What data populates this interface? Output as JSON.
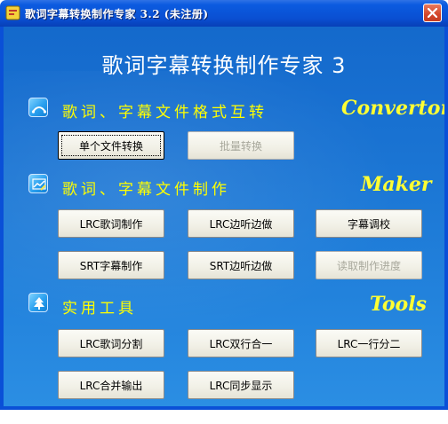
{
  "window": {
    "title": "歌词字幕转换制作专家 3.2 (未注册)"
  },
  "app_title": "歌词字幕转换制作专家 3",
  "sections": {
    "converter": {
      "title": "歌词、字幕文件格式互转",
      "tag": "Convertor",
      "icon": "arc-curve-icon",
      "buttons": {
        "single": "单个文件转换",
        "batch": "批量转换"
      }
    },
    "maker": {
      "title": "歌词、字幕文件制作",
      "tag": "Maker",
      "icon": "chart-edit-icon",
      "buttons": {
        "lrc_make": "LRC歌词制作",
        "lrc_listen": "LRC边听边做",
        "subtitle_adjust": "字幕调校",
        "srt_make": "SRT字幕制作",
        "srt_listen": "SRT边听边做",
        "read_progress": "读取制作进度"
      }
    },
    "tools": {
      "title": "实用工具",
      "tag": "Tools",
      "icon": "tree-icon",
      "buttons": {
        "lrc_split": "LRC歌词分割",
        "lrc_merge_lines": "LRC双行合一",
        "lrc_split_lines": "LRC一行分二",
        "lrc_merge_output": "LRC合并输出",
        "lrc_sync_display": "LRC同步显示"
      }
    }
  },
  "colors": {
    "titlebar": "#0a50d7",
    "client_bg": "#1a74d3",
    "section_text": "#ffff00",
    "disabled_text": "#a8a89c"
  }
}
